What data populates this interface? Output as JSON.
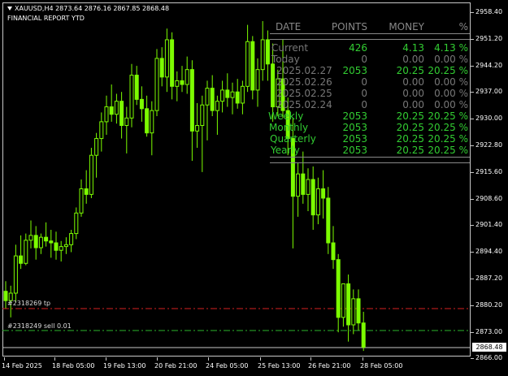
{
  "header": {
    "symbol_line": "XAUUSD,H4  2873.64 2876.16 2867.85 2868.48",
    "report_title": "FINANCIAL REPORT YTD"
  },
  "price_scale": {
    "labels": [
      "2958.40",
      "2951.20",
      "2944.20",
      "2937.00",
      "2930.00",
      "2922.80",
      "2915.60",
      "2908.60",
      "2901.40",
      "2894.40",
      "2887.20",
      "2880.20",
      "2873.00",
      "2866.00"
    ],
    "current_price": "2868.48"
  },
  "time_scale": {
    "labels": [
      "14 Feb 2025",
      "18 Feb 05:00",
      "19 Feb 13:00",
      "20 Feb 21:00",
      "24 Feb 05:00",
      "25 Feb 13:00",
      "26 Feb 21:00",
      "28 Feb 05:00"
    ]
  },
  "orders": {
    "tp_label": "#2318269 tp",
    "sell_label": "#2318249 sell 0.01",
    "tp_color": "#d42020",
    "sell_color": "#2db32d"
  },
  "report": {
    "headers": {
      "date": "DATE",
      "points": "POINTS",
      "money": "MONEY",
      "pct": "%"
    },
    "rows": [
      {
        "label": "Current",
        "points": "426",
        "money": "4.13",
        "pct": "4.13 %",
        "active": true
      },
      {
        "label": "Today",
        "points": "0",
        "money": "0.00",
        "pct": "0.00 %",
        "active": false
      },
      {
        "label": "2025.02.27",
        "points": "2053",
        "money": "20.25",
        "pct": "20.25 %",
        "active": true
      },
      {
        "label": "2025.02.26",
        "points": "0",
        "money": "0.00",
        "pct": "0.00 %",
        "active": false
      },
      {
        "label": "2025.02.25",
        "points": "0",
        "money": "0.00",
        "pct": "0.00 %",
        "active": false
      },
      {
        "label": "2025.02.24",
        "points": "0",
        "money": "0.00",
        "pct": "0.00 %",
        "active": false
      }
    ],
    "summary": [
      {
        "label": "Weekly",
        "points": "2053",
        "money": "20.25",
        "pct": "20.25 %"
      },
      {
        "label": "Monthly",
        "points": "2053",
        "money": "20.25",
        "pct": "20.25 %"
      },
      {
        "label": "Quarterly",
        "points": "2053",
        "money": "20.25",
        "pct": "20.25 %"
      },
      {
        "label": "Yearly",
        "points": "2053",
        "money": "20.25",
        "pct": "20.25 %"
      }
    ],
    "colors": {
      "positive": "#32cd32",
      "neutral": "#777777",
      "header": "#888888"
    }
  },
  "candle_color": "#7cfc00",
  "candles": [
    [
      2883.5,
      2886.2,
      2878.9,
      2881.0
    ],
    [
      2881.0,
      2885.0,
      2876.5,
      2883.0
    ],
    [
      2883.0,
      2896.0,
      2880.5,
      2893.0
    ],
    [
      2893.0,
      2898.5,
      2889.5,
      2891.0
    ],
    [
      2891.0,
      2899.0,
      2890.5,
      2897.2
    ],
    [
      2897.2,
      2902.5,
      2895.0,
      2898.5
    ],
    [
      2898.5,
      2901.0,
      2892.0,
      2895.2
    ],
    [
      2895.2,
      2899.0,
      2893.5,
      2898.0
    ],
    [
      2898.0,
      2902.0,
      2895.5,
      2897.0
    ],
    [
      2897.0,
      2900.0,
      2892.5,
      2896.5
    ],
    [
      2896.5,
      2899.5,
      2892.0,
      2894.5
    ],
    [
      2894.5,
      2897.0,
      2891.5,
      2895.5
    ],
    [
      2895.5,
      2898.0,
      2893.5,
      2896.0
    ],
    [
      2896.0,
      2900.0,
      2894.0,
      2899.0
    ],
    [
      2899.0,
      2906.0,
      2897.5,
      2904.5
    ],
    [
      2904.5,
      2913.5,
      2903.5,
      2911.0
    ],
    [
      2911.0,
      2916.0,
      2907.0,
      2909.5
    ],
    [
      2909.5,
      2922.0,
      2908.5,
      2920.0
    ],
    [
      2920.0,
      2926.0,
      2914.0,
      2924.5
    ],
    [
      2924.5,
      2931.5,
      2921.0,
      2929.0
    ],
    [
      2929.0,
      2936.0,
      2925.5,
      2933.0
    ],
    [
      2933.0,
      2939.0,
      2929.0,
      2931.0
    ],
    [
      2931.0,
      2936.5,
      2928.5,
      2934.5
    ],
    [
      2934.5,
      2937.0,
      2924.5,
      2928.0
    ],
    [
      2928.0,
      2933.0,
      2920.5,
      2930.0
    ],
    [
      2930.0,
      2944.5,
      2927.5,
      2941.5
    ],
    [
      2941.5,
      2944.0,
      2933.5,
      2935.0
    ],
    [
      2935.0,
      2938.5,
      2929.0,
      2932.5
    ],
    [
      2932.5,
      2936.0,
      2925.0,
      2926.0
    ],
    [
      2926.0,
      2934.5,
      2920.0,
      2932.0
    ],
    [
      2932.0,
      2948.5,
      2930.5,
      2946.0
    ],
    [
      2946.0,
      2949.0,
      2938.5,
      2941.0
    ],
    [
      2941.0,
      2954.0,
      2937.0,
      2951.0
    ],
    [
      2951.0,
      2953.0,
      2935.0,
      2938.5
    ],
    [
      2938.5,
      2942.5,
      2934.5,
      2940.0
    ],
    [
      2940.0,
      2944.0,
      2937.0,
      2939.0
    ],
    [
      2939.0,
      2946.5,
      2936.5,
      2943.0
    ],
    [
      2943.0,
      2945.5,
      2918.5,
      2926.5
    ],
    [
      2926.5,
      2934.0,
      2922.0,
      2928.0
    ],
    [
      2928.0,
      2936.0,
      2915.5,
      2933.5
    ],
    [
      2933.5,
      2940.0,
      2924.0,
      2938.0
    ],
    [
      2938.0,
      2941.5,
      2930.5,
      2932.0
    ],
    [
      2932.0,
      2936.0,
      2925.5,
      2934.5
    ],
    [
      2934.5,
      2940.0,
      2931.5,
      2937.5
    ],
    [
      2937.5,
      2942.0,
      2933.0,
      2935.5
    ],
    [
      2935.5,
      2939.5,
      2931.0,
      2937.0
    ],
    [
      2937.0,
      2940.5,
      2932.5,
      2934.0
    ],
    [
      2934.0,
      2940.0,
      2931.0,
      2938.5
    ],
    [
      2938.5,
      2955.0,
      2937.0,
      2950.5
    ],
    [
      2950.5,
      2952.0,
      2935.0,
      2937.5
    ],
    [
      2937.5,
      2946.0,
      2933.0,
      2943.0
    ],
    [
      2943.0,
      2956.0,
      2940.0,
      2951.0
    ],
    [
      2951.0,
      2953.5,
      2940.0,
      2944.5
    ],
    [
      2944.5,
      2950.0,
      2929.0,
      2933.0
    ],
    [
      2933.0,
      2943.0,
      2930.5,
      2940.5
    ],
    [
      2940.5,
      2951.0,
      2930.0,
      2932.0
    ],
    [
      2932.0,
      2935.5,
      2920.0,
      2924.5
    ],
    [
      2924.5,
      2930.0,
      2895.0,
      2909.0
    ],
    [
      2909.0,
      2918.0,
      2903.5,
      2915.0
    ],
    [
      2915.0,
      2921.0,
      2907.0,
      2909.5
    ],
    [
      2909.5,
      2916.5,
      2905.0,
      2913.5
    ],
    [
      2913.5,
      2917.0,
      2900.0,
      2904.0
    ],
    [
      2904.0,
      2914.0,
      2901.5,
      2911.0
    ],
    [
      2911.0,
      2916.0,
      2903.0,
      2908.5
    ],
    [
      2908.5,
      2911.5,
      2893.5,
      2896.5
    ],
    [
      2896.5,
      2901.0,
      2889.5,
      2892.0
    ],
    [
      2892.0,
      2893.5,
      2872.5,
      2876.5
    ],
    [
      2876.5,
      2884.0,
      2874.0,
      2885.5
    ],
    [
      2885.5,
      2888.0,
      2870.0,
      2874.5
    ],
    [
      2874.5,
      2884.0,
      2872.0,
      2881.5
    ],
    [
      2881.5,
      2884.0,
      2873.0,
      2875.0
    ],
    [
      2875.0,
      2878.0,
      2867.5,
      2868.5
    ]
  ]
}
